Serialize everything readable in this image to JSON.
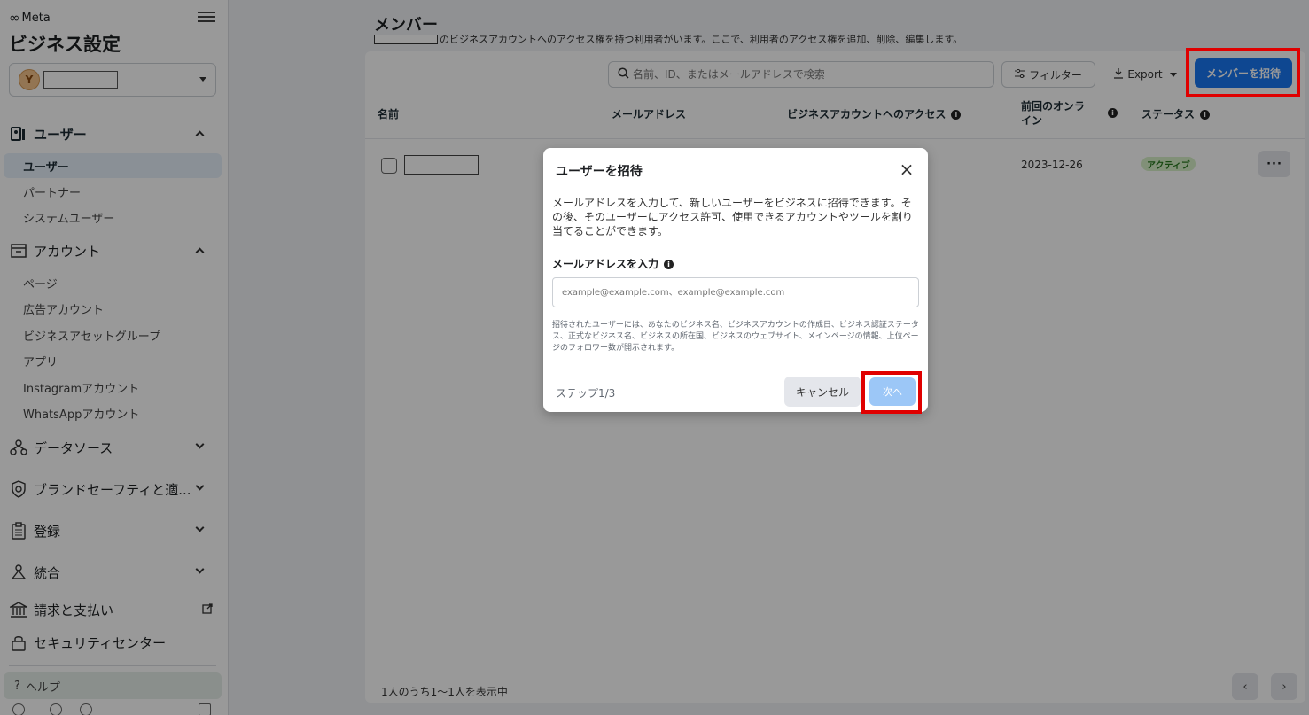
{
  "app": {
    "brand": "Meta",
    "title": "ビジネス設定"
  },
  "account": {
    "avatar_letter": "Y"
  },
  "sidebar": {
    "users_section": "ユーザー",
    "users_items": [
      "ユーザー",
      "パートナー",
      "システムユーザー"
    ],
    "accounts_section": "アカウント",
    "accounts_items": [
      "ページ",
      "広告アカウント",
      "ビジネスアセットグループ",
      "アプリ",
      "Instagramアカウント",
      "WhatsAppアカウント"
    ],
    "data_sources": "データソース",
    "brand_safety": "ブランドセーフティと適...",
    "registration": "登録",
    "integration": "統合",
    "billing": "請求と支払い",
    "security": "セキュリティセンター",
    "help": "ヘルプ"
  },
  "header": {
    "title": "メンバー",
    "subtitle": "のビジネスアカウントへのアクセス権を持つ利用者がいます。ここで、利用者のアクセス権を追加、削除、編集します。"
  },
  "toolbar": {
    "search_placeholder": "名前、ID、またはメールアドレスで検索",
    "filter_label": "フィルター",
    "export_label": "Export",
    "invite_label": "メンバーを招待"
  },
  "table": {
    "columns": [
      "名前",
      "メールアドレス",
      "ビジネスアカウントへのアクセス",
      "前回のオンライン",
      "ステータス"
    ],
    "rows": [
      {
        "last_online": "2023-12-26",
        "status": "アクティブ",
        "more": "···"
      }
    ]
  },
  "footer": {
    "count_text": "1人のうち1～1人を表示中"
  },
  "modal": {
    "title": "ユーザーを招待",
    "description": "メールアドレスを入力して、新しいユーザーをビジネスに招待できます。その後、そのユーザーにアクセス許可、使用できるアカウントやツールを割り当てることができます。",
    "email_label": "メールアドレスを入力",
    "email_placeholder": "example@example.com、example@example.com",
    "note": "招待されたユーザーには、あなたのビジネス名、ビジネスアカウントの作成日、ビジネス認証ステータス、正式なビジネス名、ビジネスの所在国、ビジネスのウェブサイト、メインページの情報、上位ページのフォロワー数が開示されます。",
    "step": "ステップ1/3",
    "cancel": "キャンセル",
    "next": "次へ"
  },
  "colors": {
    "primary": "#1877f2",
    "highlight": "#e00000",
    "status_green": "#d7f0c8"
  }
}
